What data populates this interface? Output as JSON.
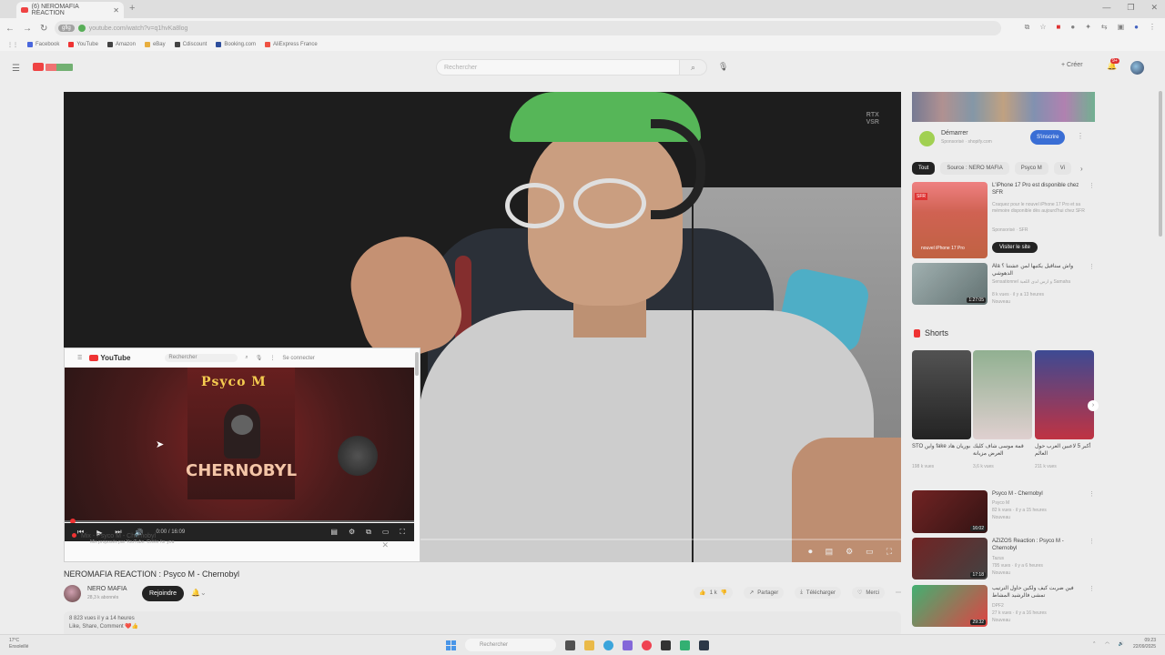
{
  "browser": {
    "tab_title": "(6) NEROMAFIA REACTION",
    "new_tab": "+",
    "url": "youtube.com/watch?v=q1hvKa8log",
    "url_chip": "gflg",
    "bookmarks": [
      "Facebook",
      "YouTube",
      "Amazon",
      "eBay",
      "Cdiscount",
      "Booking.com",
      "AliExpress France"
    ]
  },
  "youtube_header": {
    "search_placeholder": "Rechercher",
    "create_label": "+ Créer",
    "notif_count": "9+"
  },
  "player": {
    "overlay_badge_line1": "RTX",
    "overlay_badge_line2": "VSR"
  },
  "mini_player": {
    "logo_text": "YouTube",
    "search_placeholder": "Rechercher",
    "signin": "Se connecter",
    "video_top_text": "Psyco M",
    "video_big_text": "CHERNOBYL",
    "time": "0:00 / 16:09",
    "playlist_title": "Mix - Psyco M - Chernobyl",
    "playlist_sub": "Mix proposés par YouTube. Créée for you"
  },
  "video": {
    "title": "NEROMAFIA REACTION : Psyco M - Chernobyl",
    "channel_name": "NERO MAFIA",
    "subscribers": "28,3 k abonnés",
    "join_label": "Rejoindre",
    "likes": "1 k",
    "share_label": "Partager",
    "download_label": "Télécharger",
    "thanks_label": "Merci",
    "views_line": "8 823 vues  il y a 14 heures",
    "desc_line": "Like, Share, Comment ❤️👍"
  },
  "sidebar": {
    "ad": {
      "title": "Démarrer",
      "sponsor": "Sponsorisé · shopify.com",
      "subscribe_label": "S'inscrire"
    },
    "chips": [
      "Tout",
      "Source : NERO MAFIA",
      "Psyco M",
      "Vi"
    ],
    "recommendations": [
      {
        "title": "L'iPhone 17 Pro est disponible chez SFR",
        "meta1": "Craquez pour le nouvel iPhone 17 Pro et sa mémoire disponible dès aujourd'hui chez SFR",
        "meta2": "Sponsorisé · SFR",
        "thumb_label": "nouvel iPhone 17 Pro",
        "cta": "Visiter le site"
      },
      {
        "title": "Ala واش ستاقيل يكتبها لمن عشتنا ؟ الدهوشي",
        "meta1": "Sensationnel و ارس لدى اللعبة",
        "meta2": "Samaha",
        "meta3": "8 k vues · il y a 13 heures",
        "meta4": "Nouveau",
        "duration": "1:27:05"
      }
    ],
    "shorts_label": "Shorts",
    "shorts": [
      {
        "caption": "STO واين fake بوريان هاد",
        "views": "198 k vues"
      },
      {
        "caption": "قمة موسى شاف كليك العرض مزيانة",
        "views": "3,6 k vues"
      },
      {
        "caption": "أكبر 5 لاعبين العرب حول العالم",
        "views": "211 k vues"
      }
    ],
    "recs2": [
      {
        "title": "Psyco M - Chernobyl",
        "channel": "Psyco M",
        "views": "82 k vues · il y a 15 heures",
        "badge": "Nouveau",
        "duration": "16:02"
      },
      {
        "title": "AZIZOS Reaction : Psyco M - Chernobyl",
        "channel": "Tazus",
        "views": "795 vues · il y a 6 heures",
        "badge": "Nouveau",
        "duration": "17:18"
      },
      {
        "title": "فين ضربت كيف ولكين حاول الترتيب تمشى فالرشيد المشاط",
        "channel": "DPF2",
        "views": "27 k vues · il y a 16 heures",
        "badge": "Nouveau",
        "duration": "29:32"
      }
    ]
  },
  "taskbar": {
    "weather_temp": "17°C",
    "weather_desc": "Ensoleillé",
    "search_placeholder": "Rechercher",
    "time": "09:23",
    "date": "22/09/2025"
  },
  "colors": {
    "yt_red": "#e22222",
    "subscribe_blue": "#2a62d2",
    "cap_green": "#48b04a"
  }
}
